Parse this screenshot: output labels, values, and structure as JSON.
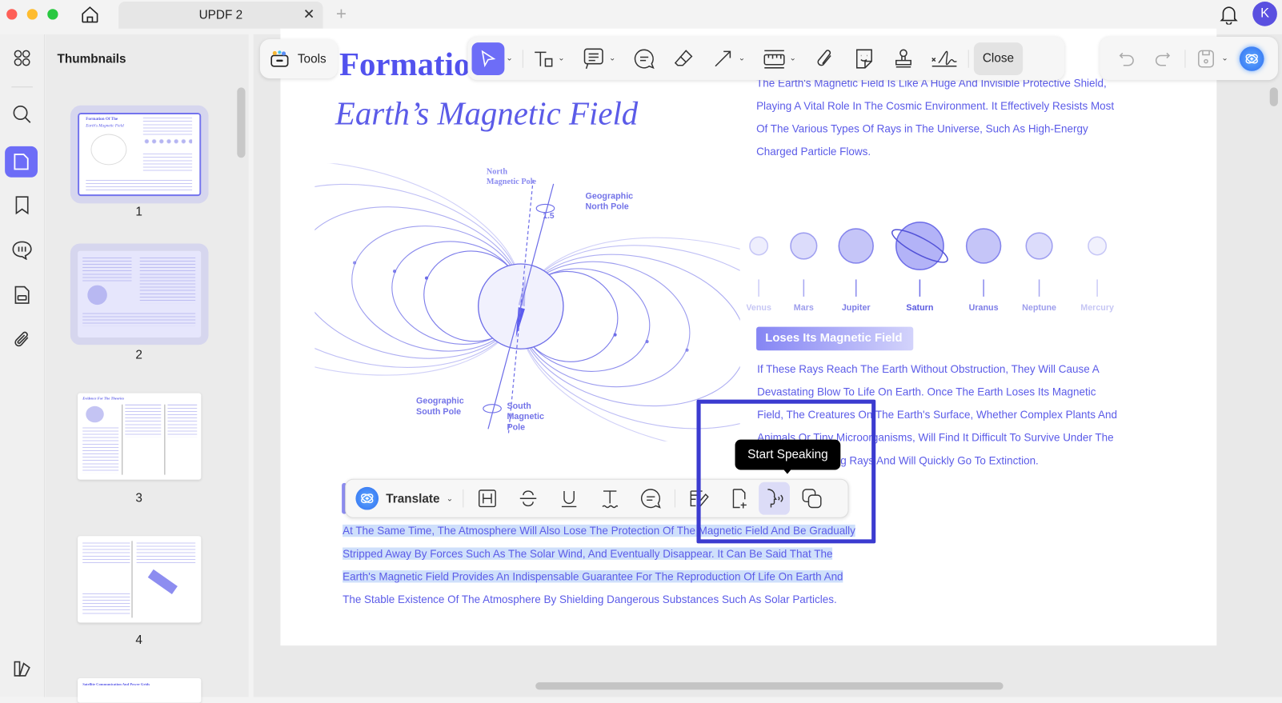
{
  "titlebar": {
    "tab_title": "UPDF 2",
    "avatar_initial": "K"
  },
  "sidebar": {
    "title": "Thumbnails",
    "pages": [
      "1",
      "2",
      "3",
      "4"
    ],
    "page5_title": "Satellite Communication And Power Grids",
    "page3_title": "Evidence For The Theories"
  },
  "toolbar": {
    "tools_label": "Tools",
    "close_label": "Close"
  },
  "document": {
    "title_line1": "Formation Of The",
    "title_visible": "Formatio",
    "title_line2": "Earth’s Magnetic Field",
    "diagram": {
      "north_magnetic_pole": [
        "North",
        "Magnetic Pole"
      ],
      "geographic_north_pole": [
        "Geographic",
        "North Pole"
      ],
      "angle": "1.5",
      "geographic_south_pole": [
        "Geographic",
        "South Pole"
      ],
      "south_magnetic_pole": [
        "South",
        "Magnetic",
        "Pole"
      ]
    },
    "intro_lines": [
      "The Earth's Magnetic Field Is Like A Huge And Invisible Protective Shield,",
      "Playing A Vital Role In The Cosmic Environment. It Effectively Resists Most",
      "Of The Various Types Of Rays in The Universe, Such As High-Energy",
      "Charged Particle Flows."
    ],
    "planets": [
      "Venus",
      "Mars",
      "Jupiter",
      "Saturn",
      "Uranus",
      "Neptune",
      "Mercury"
    ],
    "section_badge": "Loses Its Magnetic Field",
    "section_lines": [
      "If These Rays Reach The Earth Without Obstruction, They Will Cause A",
      "Devastating Blow To Life On Earth. Once The Earth Loses Its Magnetic",
      "Field, The Creatures On The Earth's Surface, Whether Complex Plants And",
      "Animals Or Tiny Microorganisms, Will Find It Difficult To Survive Under The",
      "Invasion Of Strong Rays And Will Quickly Go To Extinction."
    ],
    "selected_lines": [
      "At The Same Time, The Atmosphere Will Also Lose The Protection Of The Magnetic Field And Be Gradually",
      "Stripped Away By Forces Such As The Solar Wind, And Eventually Disappear. It Can Be Said That The",
      "Earth's Magnetic Field Provides An Indispensable Guarantee For The Reproduction Of Life On Earth And",
      "The Stable Existence Of The Atmosphere By Shielding Dangerous Substances Such As Solar Particles."
    ]
  },
  "selection_toolbar": {
    "translate_label": "Translate",
    "tooltip": "Start Speaking"
  },
  "colors": {
    "accent": "#6d6df7",
    "text_blue": "#5b5be8",
    "highlight_box": "#3b3bd0",
    "selection": "#cfe0fb"
  }
}
